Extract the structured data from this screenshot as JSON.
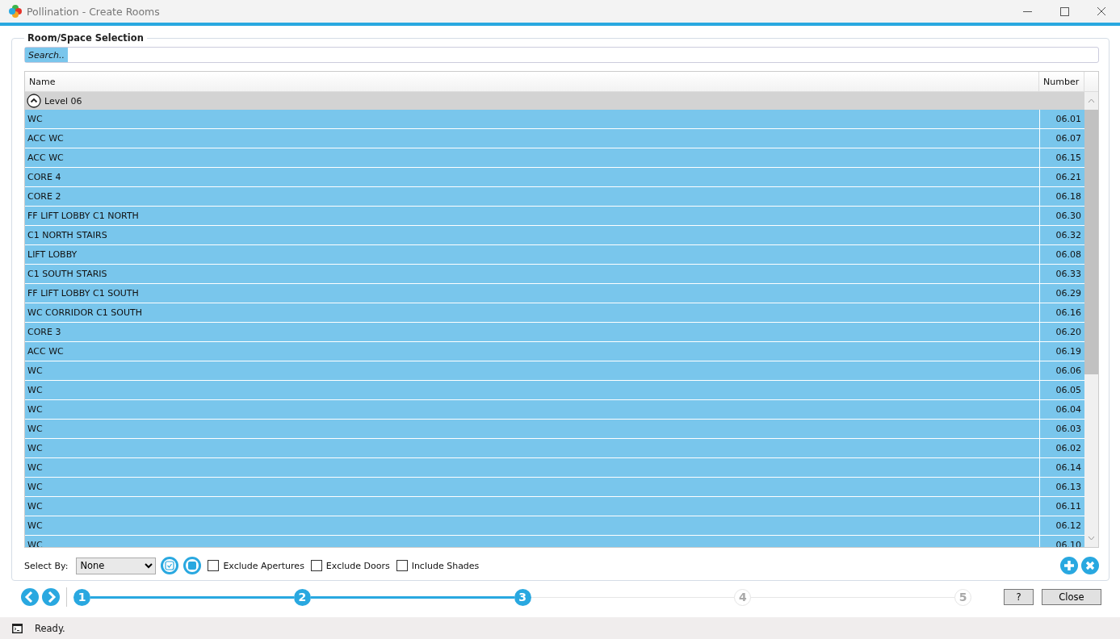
{
  "window": {
    "title": "Pollination - Create Rooms"
  },
  "group_title": "Room/Space Selection",
  "search": {
    "placeholder": "Search.."
  },
  "table": {
    "columns": [
      "Name",
      "Number"
    ],
    "group": {
      "label": "Level 06",
      "expanded": true
    },
    "rows": [
      {
        "name": "WC",
        "number": "06.01",
        "selected": true
      },
      {
        "name": "ACC WC",
        "number": "06.07",
        "selected": true
      },
      {
        "name": "ACC WC",
        "number": "06.15",
        "selected": true
      },
      {
        "name": "CORE 4",
        "number": "06.21",
        "selected": true
      },
      {
        "name": "CORE 2",
        "number": "06.18",
        "selected": true
      },
      {
        "name": "FF LIFT LOBBY C1 NORTH",
        "number": "06.30",
        "selected": true
      },
      {
        "name": "C1 NORTH STAIRS",
        "number": "06.32",
        "selected": true
      },
      {
        "name": "LIFT LOBBY",
        "number": "06.08",
        "selected": true
      },
      {
        "name": "C1 SOUTH STARIS",
        "number": "06.33",
        "selected": true
      },
      {
        "name": "FF LIFT LOBBY C1 SOUTH",
        "number": "06.29",
        "selected": true
      },
      {
        "name": "WC CORRIDOR C1 SOUTH",
        "number": "06.16",
        "selected": true
      },
      {
        "name": "CORE 3",
        "number": "06.20",
        "selected": true
      },
      {
        "name": "ACC WC",
        "number": "06.19",
        "selected": true
      },
      {
        "name": "WC",
        "number": "06.06",
        "selected": true
      },
      {
        "name": "WC",
        "number": "06.05",
        "selected": true
      },
      {
        "name": "WC",
        "number": "06.04",
        "selected": true
      },
      {
        "name": "WC",
        "number": "06.03",
        "selected": true
      },
      {
        "name": "WC",
        "number": "06.02",
        "selected": true
      },
      {
        "name": "WC",
        "number": "06.14",
        "selected": true
      },
      {
        "name": "WC",
        "number": "06.13",
        "selected": true
      },
      {
        "name": "WC",
        "number": "06.11",
        "selected": true
      },
      {
        "name": "WC",
        "number": "06.12",
        "selected": true
      },
      {
        "name": "WC",
        "number": "06.10",
        "selected": true
      }
    ]
  },
  "select_by": {
    "label": "Select By:",
    "value": "None"
  },
  "checkboxes": [
    {
      "label": "Exclude Apertures",
      "checked": false
    },
    {
      "label": "Exclude Doors",
      "checked": false
    },
    {
      "label": "Include Shades",
      "checked": false
    }
  ],
  "steps": [
    {
      "label": "1",
      "done": true
    },
    {
      "label": "2",
      "done": true
    },
    {
      "label": "3",
      "done": true
    },
    {
      "label": "4",
      "done": false
    },
    {
      "label": "5",
      "done": false
    }
  ],
  "buttons": [
    "?",
    "Close"
  ],
  "status_bar": {
    "text": "Ready."
  }
}
